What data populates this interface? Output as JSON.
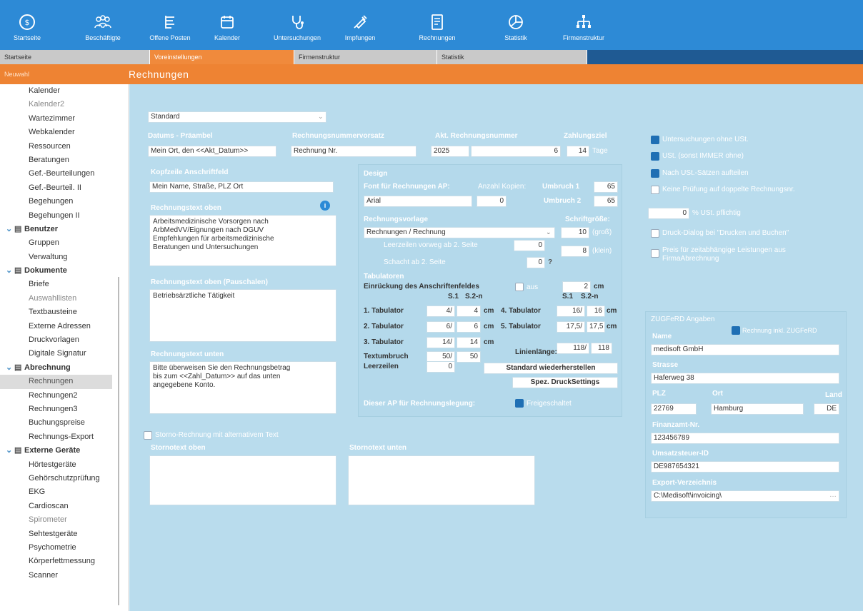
{
  "toolbar": [
    {
      "label": "Startseite",
      "icon": "home-icon"
    },
    {
      "label": "Beschäftigte",
      "icon": "employees-icon"
    },
    {
      "label": "Offene Posten",
      "icon": "open-items-icon"
    },
    {
      "label": "Kalender",
      "icon": "calendar-icon"
    },
    {
      "label": "Untersuchungen",
      "icon": "stethoscope-icon"
    },
    {
      "label": "Impfungen",
      "icon": "syringe-icon"
    },
    {
      "label": "Rechnungen",
      "icon": "invoice-icon"
    },
    {
      "label": "Statistik",
      "icon": "pie-chart-icon"
    },
    {
      "label": "Firmenstruktur",
      "icon": "org-chart-icon"
    }
  ],
  "tabs": [
    "Startseite",
    "Voreinstellungen",
    "Firmenstruktur",
    "Statistik"
  ],
  "titlebar": {
    "new": "Neuwahl",
    "title": "Rechnungen"
  },
  "sidebar": [
    {
      "label": "Kalender",
      "type": "item"
    },
    {
      "label": "Kalender2",
      "type": "muted"
    },
    {
      "label": "Wartezimmer",
      "type": "item"
    },
    {
      "label": "Webkalender",
      "type": "item"
    },
    {
      "label": "Ressourcen",
      "type": "item"
    },
    {
      "label": "Beratungen",
      "type": "item"
    },
    {
      "label": "Gef.-Beurteilungen",
      "type": "item"
    },
    {
      "label": "Gef.-Beurteil. II",
      "type": "item"
    },
    {
      "label": "Begehungen",
      "type": "item"
    },
    {
      "label": "Begehungen II",
      "type": "item"
    },
    {
      "label": "Benutzer",
      "type": "group"
    },
    {
      "label": "Gruppen",
      "type": "item"
    },
    {
      "label": "Verwaltung",
      "type": "item"
    },
    {
      "label": "Dokumente",
      "type": "group"
    },
    {
      "label": "Briefe",
      "type": "item"
    },
    {
      "label": "Auswahllisten",
      "type": "muted"
    },
    {
      "label": "Textbausteine",
      "type": "item"
    },
    {
      "label": "Externe Adressen",
      "type": "item"
    },
    {
      "label": "Druckvorlagen",
      "type": "item"
    },
    {
      "label": "Digitale Signatur",
      "type": "item"
    },
    {
      "label": "Abrechnung",
      "type": "group"
    },
    {
      "label": "Rechnungen",
      "type": "active"
    },
    {
      "label": "Rechnungen2",
      "type": "item"
    },
    {
      "label": "Rechnungen3",
      "type": "item"
    },
    {
      "label": "Buchungspreise",
      "type": "item"
    },
    {
      "label": "Rechnungs-Export",
      "type": "item"
    },
    {
      "label": "Externe Geräte",
      "type": "group"
    },
    {
      "label": "Hörtestgeräte",
      "type": "item"
    },
    {
      "label": "Gehörschutzprüfung",
      "type": "item"
    },
    {
      "label": "EKG",
      "type": "item"
    },
    {
      "label": "Cardioscan",
      "type": "item"
    },
    {
      "label": "Spirometer",
      "type": "muted"
    },
    {
      "label": "Sehtestgeräte",
      "type": "item"
    },
    {
      "label": "Psychometrie",
      "type": "item"
    },
    {
      "label": "Körperfettmessung",
      "type": "item"
    },
    {
      "label": "Scanner",
      "type": "item"
    }
  ],
  "form": {
    "standard": "Standard",
    "datum_label": "Datums - Präambel",
    "datum_value": "Mein Ort, den <<Akt_Datum>>",
    "rnvorsatz_label": "Rechnungsnummervorsatz",
    "rnvorsatz_value": "Rechnung Nr.",
    "aktrn_label": "Akt. Rechnungsnummer",
    "aktrn_year": "2025",
    "aktrn_num": "6",
    "zahlungsziel_label": "Zahlungsziel",
    "zahlungsziel_value": "14",
    "tage": "Tage",
    "kopf_label": "Kopfzeile Anschriftfeld",
    "kopf_value": "Mein Name, Straße, PLZ Ort",
    "rtext_oben_label": "Rechnungstext oben",
    "rtext_oben_value": "Arbeitsmedizinische Vorsorgen nach\nArbMedVV/Eignungen nach DGUV\nEmpfehlungen für arbeitsmedizinische\nBeratungen und Untersuchungen",
    "rtext_pausch_label": "Rechnungstext oben (Pauschalen)",
    "rtext_pausch_value": "Betriebsärztliche Tätigkeit",
    "rtext_unten_label": "Rechnungstext unten",
    "rtext_unten_value": "Bitte überweisen Sie den Rechnungsbetrag\nbis zum <<Zahl_Datum>> auf das unten\nangegebene Konto.",
    "storno_check": "Storno-Rechnung mit alternativem Text",
    "storno_oben": "Stornotext oben",
    "storno_unten": "Stornotext unten"
  },
  "design": {
    "title": "Design",
    "font_label": "Font für Rechnungen AP:",
    "font_value": "Arial",
    "kopien_label": "Anzahl Kopien:",
    "kopien_value": "0",
    "umbruch1_label": "Umbruch 1",
    "umbruch1_value": "65",
    "umbruch2_label": "Umbruch 2",
    "umbruch2_value": "65",
    "vorlage_label": "Rechnungsvorlage",
    "vorlage_value": "Rechnungen / Rechnung",
    "schrift_label": "Schriftgröße:",
    "schrift_gross": "10",
    "gross": "(groß)",
    "schrift_klein": "8",
    "klein": "(klein)",
    "leerzeilen_vorweg": "Leerzeilen vorweg ab 2. Seite",
    "leerzeilen_vorweg_value": "0",
    "schacht": "Schacht ab 2. Seite",
    "schacht_value": "0",
    "q": "?",
    "tab_title": "Tabulatoren",
    "einr": "Einrückung des Anschriftenfeldes",
    "aus": "aus",
    "einr_value": "2",
    "cm": "cm",
    "s1": "S.1",
    "s2": "S.2-n",
    "tab1": "1. Tabulator",
    "tab1_a": "4/",
    "tab1_b": "4",
    "tab2": "2. Tabulator",
    "tab2_a": "6/",
    "tab2_b": "6",
    "tab3": "3. Tabulator",
    "tab3_a": "14/",
    "tab3_b": "14",
    "tab4": "4. Tabulator",
    "tab4_a": "16/",
    "tab4_b": "16",
    "tab5": "5. Tabulator",
    "tab5_a": "17,5/",
    "tab5_b": "17,5",
    "textumbruch": "Textumbruch",
    "tu_a": "50/",
    "tu_b": "50",
    "linienlaenge": "Linienlänge:",
    "ll_a": "118/",
    "ll_b": "118",
    "leerzeilen": "Leerzeilen",
    "leerzeilen_value": "0",
    "btn_standard": "Standard wiederherstellen",
    "btn_spez": "Spez. DruckSettings",
    "ap_label": "Dieser AP für Rechnungslegung:",
    "freigeschaltet": "Freigeschaltet"
  },
  "options": {
    "ohne_ust": "Untersuchungen ohne USt.",
    "ust_immer": "USt. (sonst IMMER ohne)",
    "nach_ust": "Nach USt.-Sätzen aufteilen",
    "keine_pruefung": "Keine Prüfung auf doppelte Rechnungsnr.",
    "ust_pct": "0",
    "ust_pflichtig": "% USt. pflichtig",
    "druck_dialog": "Druck-Dialog bei \"Drucken und Buchen\"",
    "preis_zeit": "Preis für zeitabhängige Leistungen aus FirmaAbrechnung"
  },
  "zugferd": {
    "title": "ZUGFeRD Angaben",
    "inkl": "Rechnung inkl. ZUGFeRD",
    "name_label": "Name",
    "name_value": "medisoft GmbH",
    "strasse_label": "Strasse",
    "strasse_value": "Haferweg 38",
    "plz_label": "PLZ",
    "ort_label": "Ort",
    "land_label": "Land",
    "plz_value": "22769",
    "ort_value": "Hamburg",
    "land_value": "DE",
    "fin_label": "Finanzamt-Nr.",
    "fin_value": "123456789",
    "ust_label": "Umsatzsteuer-ID",
    "ust_value": "DE987654321",
    "export_label": "Export-Verzeichnis",
    "export_value": "C:\\Medisoft\\invoicing\\"
  },
  "colors": {
    "toolbar": "#2d8ad6",
    "accent": "#ee8333",
    "panel": "#b9dced",
    "check": "#1f6fb4"
  }
}
